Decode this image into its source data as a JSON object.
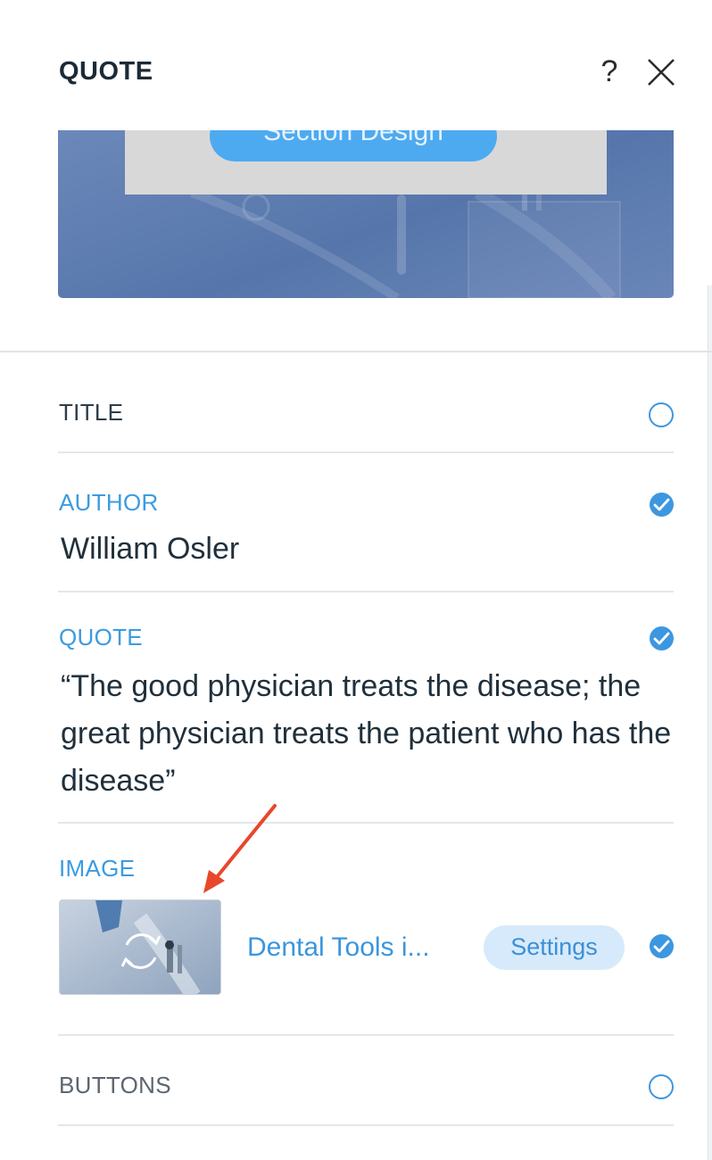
{
  "panel": {
    "title": "QUOTE",
    "help_icon": "question-icon",
    "close_icon": "close-icon"
  },
  "preview": {
    "button_label": "Section Design"
  },
  "sections": {
    "title": {
      "label": "TITLE",
      "enabled": false
    },
    "author": {
      "label": "AUTHOR",
      "value": "William Osler",
      "enabled": true
    },
    "quote": {
      "label": "QUOTE",
      "value": "“The good physician treats the disease; the great physician treats the patient who has the disease”",
      "enabled": true
    },
    "image": {
      "label": "IMAGE",
      "file_name": "Dental Tools i...",
      "settings_label": "Settings",
      "enabled": true,
      "thumb_icon": "replace-image-icon"
    },
    "buttons": {
      "label": "BUTTONS",
      "enabled": false
    }
  },
  "colors": {
    "accent": "#3d97e0",
    "annotation_arrow": "#e8472b"
  }
}
